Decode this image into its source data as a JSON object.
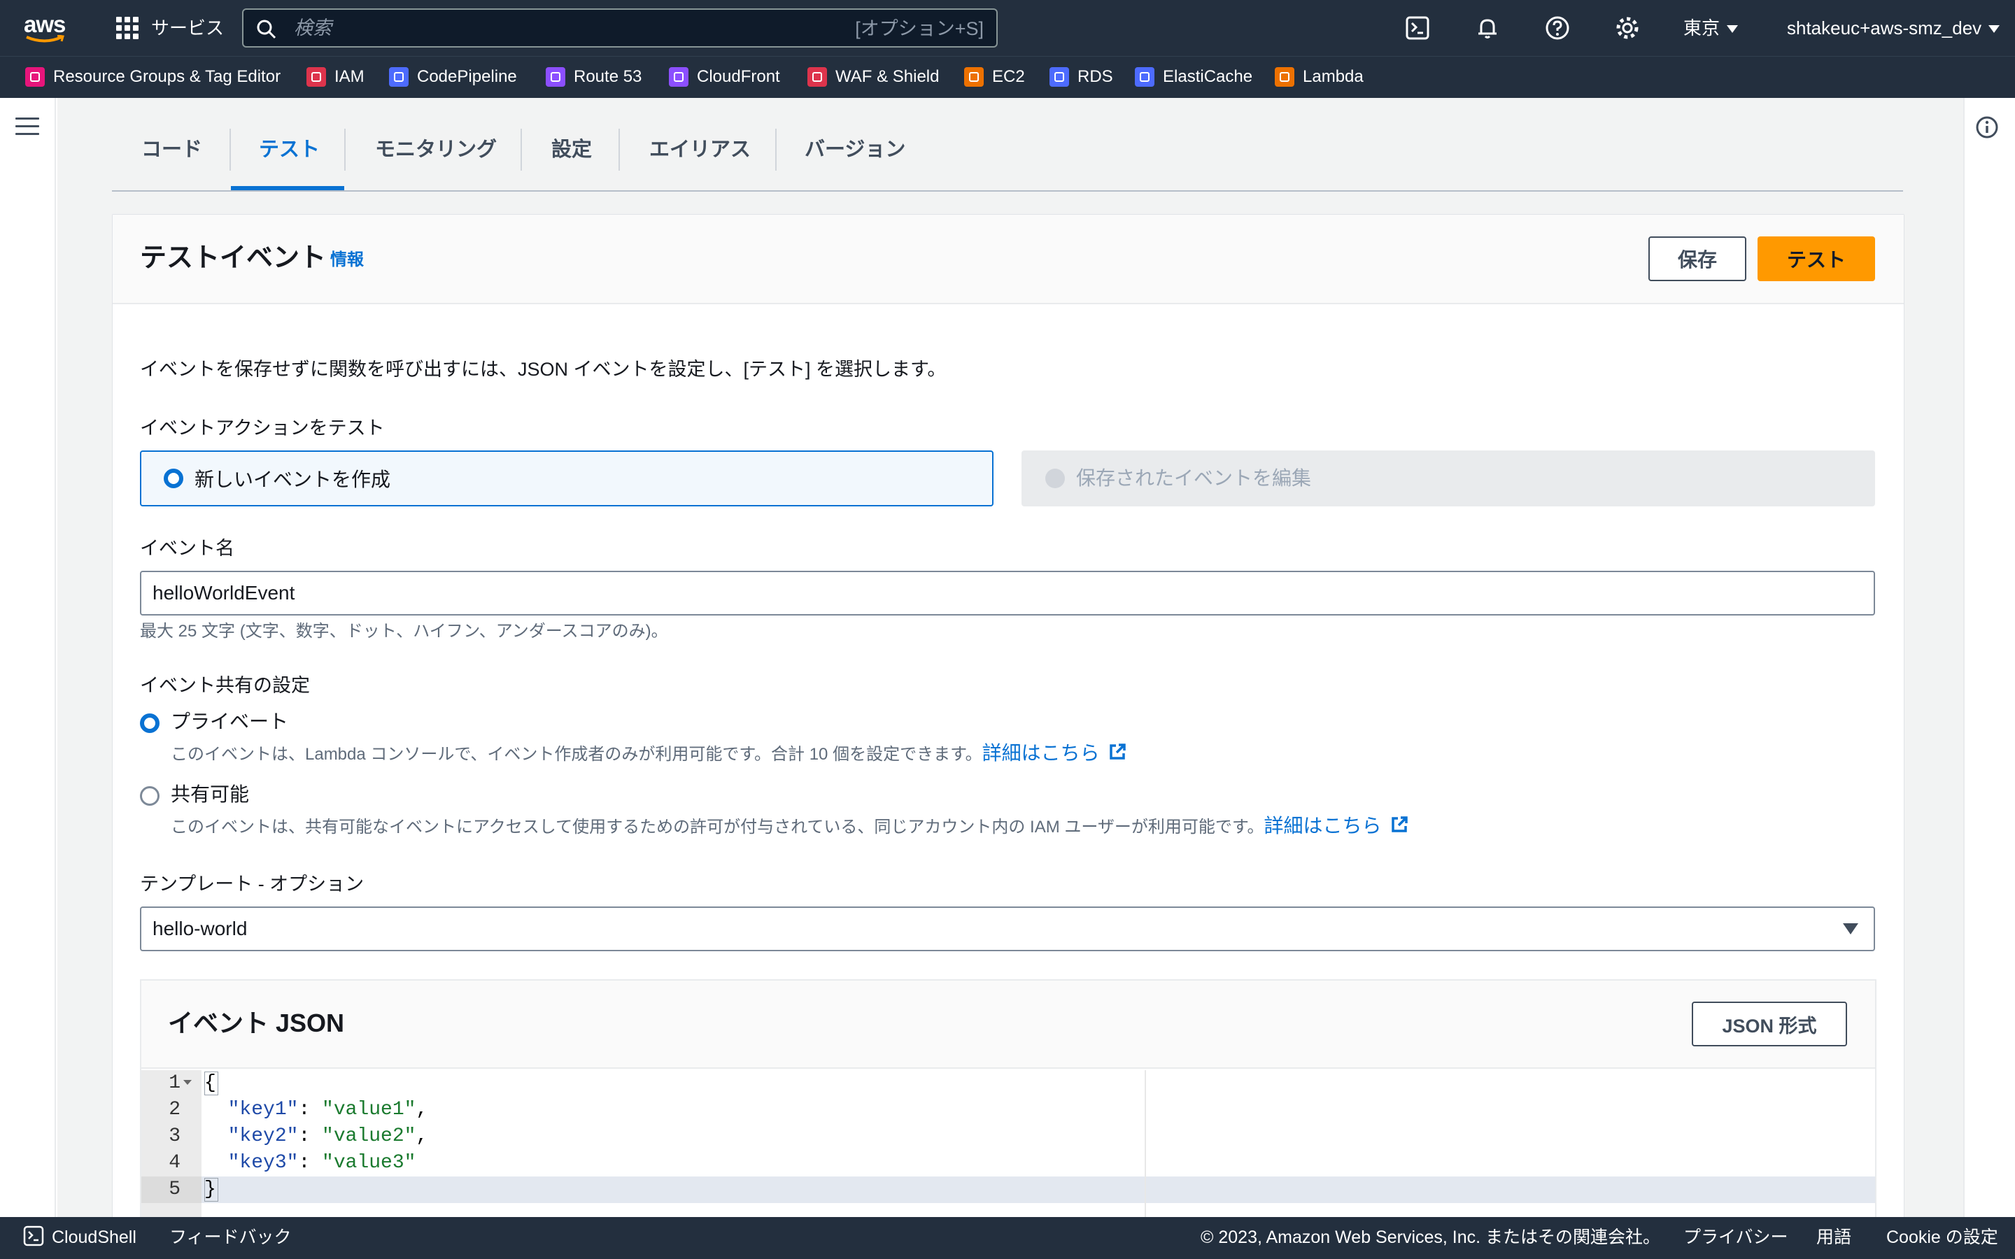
{
  "topnav": {
    "logo_text": "aws",
    "services_label": "サービス",
    "search_placeholder": "検索",
    "search_hint": "[オプション+S]",
    "region": "東京",
    "account": "shtakeuc+aws-smz_dev",
    "icons": [
      "cloudshell-icon",
      "bell-icon",
      "help-icon",
      "gear-icon"
    ]
  },
  "favorites": [
    {
      "label": "Resource Groups & Tag Editor",
      "color": "#e7157b"
    },
    {
      "label": "IAM",
      "color": "#dd344c"
    },
    {
      "label": "CodePipeline",
      "color": "#4d6bfe"
    },
    {
      "label": "Route 53",
      "color": "#8c4fff"
    },
    {
      "label": "CloudFront",
      "color": "#8c4fff"
    },
    {
      "label": "WAF & Shield",
      "color": "#dd344c"
    },
    {
      "label": "EC2",
      "color": "#ed7100"
    },
    {
      "label": "RDS",
      "color": "#4d6bfe"
    },
    {
      "label": "ElastiCache",
      "color": "#4d6bfe"
    },
    {
      "label": "Lambda",
      "color": "#ed7100"
    }
  ],
  "tabs": [
    {
      "label": "コード",
      "active": false
    },
    {
      "label": "テスト",
      "active": true
    },
    {
      "label": "モニタリング",
      "active": false
    },
    {
      "label": "設定",
      "active": false
    },
    {
      "label": "エイリアス",
      "active": false
    },
    {
      "label": "バージョン",
      "active": false
    }
  ],
  "panel": {
    "title": "テストイベント",
    "info_link": "情報",
    "save_button": "保存",
    "test_button": "テスト",
    "description": "イベントを保存せずに関数を呼び出すには、JSON イベントを設定し、[テスト] を選択します。",
    "action_label": "イベントアクションをテスト",
    "action_create": "新しいイベントを作成",
    "action_edit": "保存されたイベントを編集",
    "event_name_label": "イベント名",
    "event_name_value": "helloWorldEvent",
    "event_name_constraint": "最大 25 文字 (文字、数字、ドット、ハイフン、アンダースコアのみ)。",
    "sharing_label": "イベント共有の設定",
    "private_label": "プライベート",
    "private_desc": "このイベントは、Lambda コンソールで、イベント作成者のみが利用可能です。合計 10 個を設定できます。",
    "shareable_label": "共有可能",
    "shareable_desc": "このイベントは、共有可能なイベントにアクセスして使用するための許可が付与されている、同じアカウント内の IAM ユーザーが利用可能です。",
    "learn_more": "詳細はこちら",
    "template_label": "テンプレート - オプション",
    "template_value": "hello-world",
    "json_title": "イベント JSON",
    "json_format_button": "JSON 形式"
  },
  "editor": {
    "lines": [
      {
        "n": "1",
        "text": "{"
      },
      {
        "n": "2",
        "key": "\"key1\"",
        "val": "\"value1\"",
        "comma": ","
      },
      {
        "n": "3",
        "key": "\"key2\"",
        "val": "\"value2\"",
        "comma": ","
      },
      {
        "n": "4",
        "key": "\"key3\"",
        "val": "\"value3\"",
        "comma": ""
      },
      {
        "n": "5",
        "text": "}"
      }
    ]
  },
  "footer": {
    "cloudshell": "CloudShell",
    "feedback": "フィードバック",
    "copyright": "© 2023, Amazon Web Services, Inc. またはその関連会社。",
    "privacy": "プライバシー",
    "terms": "用語",
    "cookie": "Cookie の設定"
  }
}
